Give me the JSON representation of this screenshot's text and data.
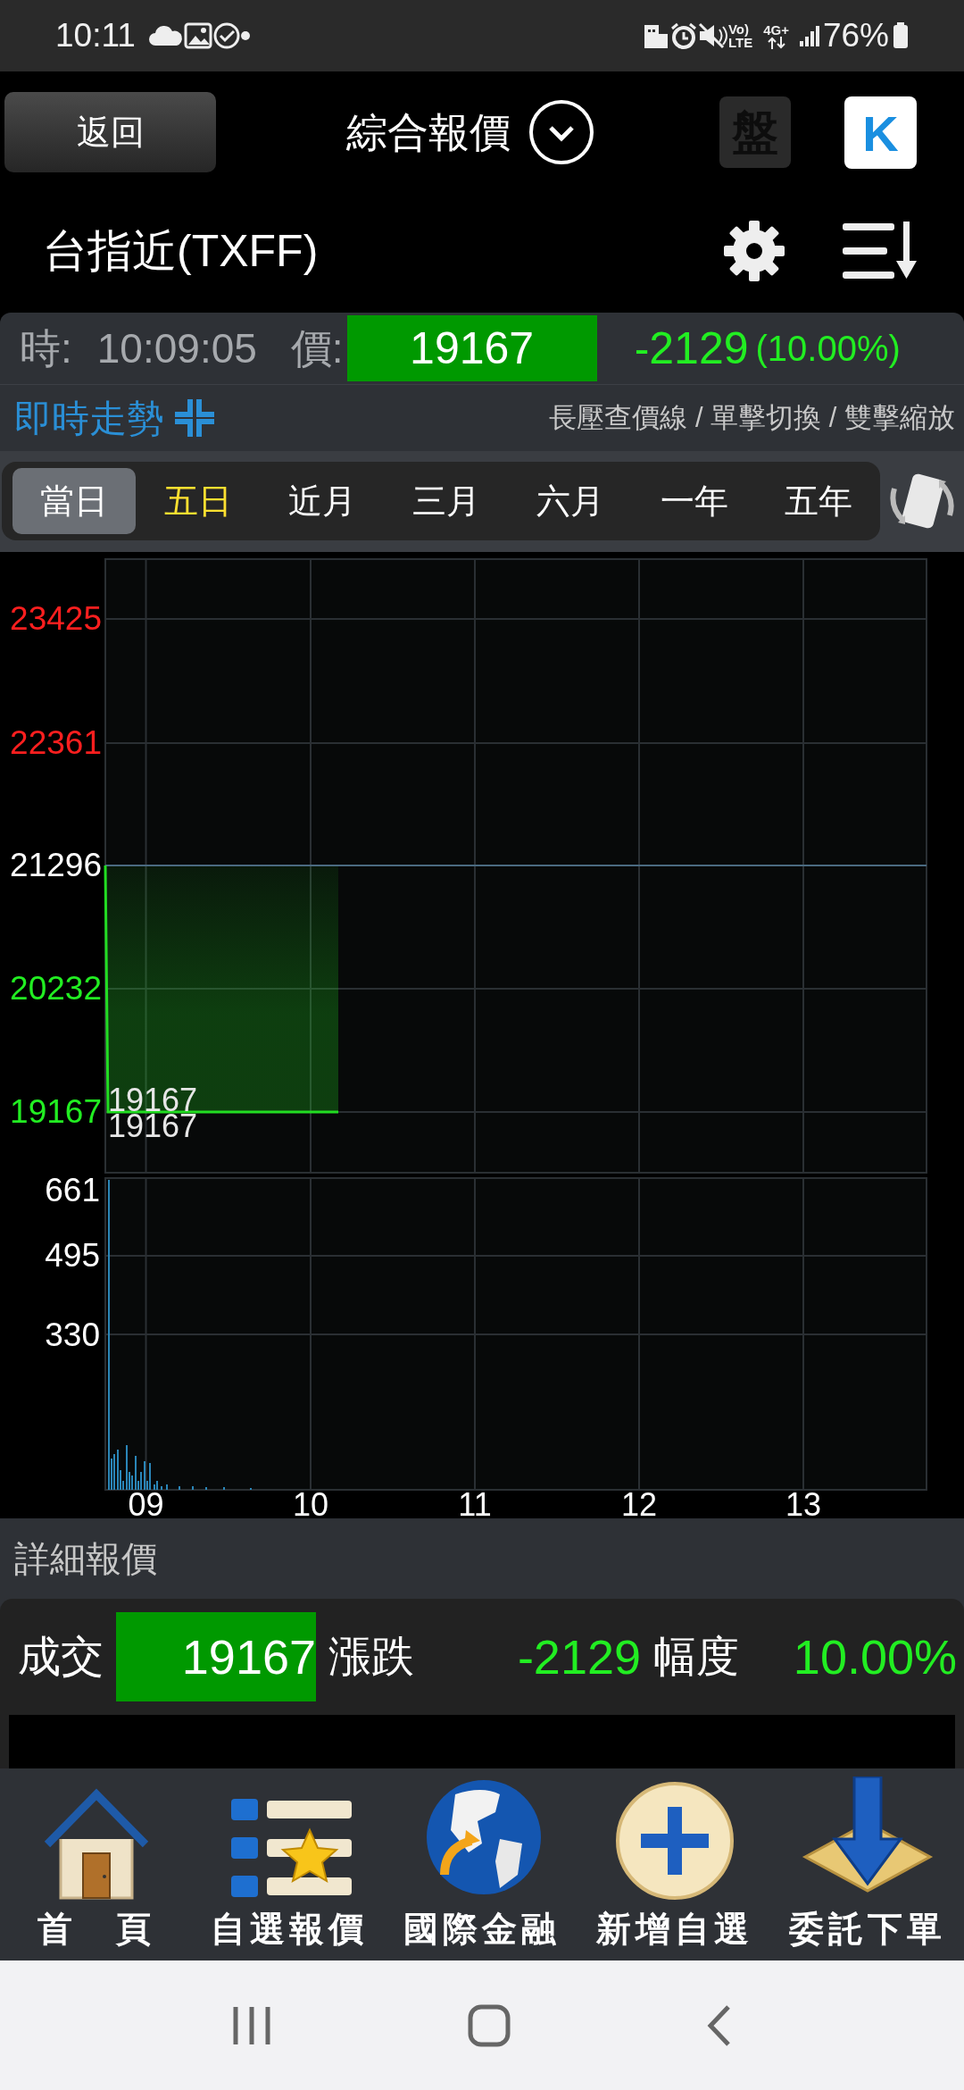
{
  "status_bar": {
    "time": "10:11",
    "volte_top": "Vo)",
    "volte_bottom": "LTE",
    "network": "4G+",
    "battery": "76%"
  },
  "header": {
    "back_button": "返回",
    "title": "綜合報價",
    "board_button": "盤",
    "k_button": "K"
  },
  "instrument": {
    "name": "台指近(TXFF)"
  },
  "quote_bar": {
    "time_label": "時:",
    "time": "10:09:05",
    "price_label": "價:",
    "price": "19167",
    "change": "-2129",
    "change_percent": "(10.00%)"
  },
  "chart_header": {
    "title": "即時走勢",
    "hint": "長壓查價線 / 單擊切換 / 雙擊縮放"
  },
  "tabs": [
    {
      "label": "當日",
      "selected": true,
      "highlighted": false
    },
    {
      "label": "五日",
      "selected": false,
      "highlighted": true
    },
    {
      "label": "近月",
      "selected": false,
      "highlighted": false
    },
    {
      "label": "三月",
      "selected": false,
      "highlighted": false
    },
    {
      "label": "六月",
      "selected": false,
      "highlighted": false
    },
    {
      "label": "一年",
      "selected": false,
      "highlighted": false
    },
    {
      "label": "五年",
      "selected": false,
      "highlighted": false
    }
  ],
  "price_chart": {
    "y_labels": [
      {
        "text": "23425",
        "color": "#ff1f1f"
      },
      {
        "text": "22361",
        "color": "#ff1f1f"
      },
      {
        "text": "21296",
        "color": "#ffffff"
      },
      {
        "text": "20232",
        "color": "#22ee22"
      },
      {
        "text": "19167",
        "color": "#22ee22"
      }
    ],
    "x_labels": [
      "09",
      "10",
      "11",
      "12",
      "13"
    ],
    "price_labels": [
      "19167",
      "19167"
    ]
  },
  "volume_chart": {
    "y_labels": [
      "661",
      "495",
      "330"
    ]
  },
  "detail": {
    "title": "詳細報價",
    "cells": [
      {
        "label": "成交",
        "value": "19167",
        "kind": "boxed"
      },
      {
        "label": "漲跌",
        "value": "-2129",
        "kind": "plain"
      },
      {
        "label": "幅度",
        "value": "10.00%",
        "kind": "plain"
      }
    ]
  },
  "bottom_nav": [
    {
      "label": "首　頁",
      "kind": "home"
    },
    {
      "label": "自選報價",
      "kind": "watchlist"
    },
    {
      "label": "國際金融",
      "kind": "globe"
    },
    {
      "label": "新增自選",
      "kind": "add"
    },
    {
      "label": "委託下單",
      "kind": "order"
    }
  ]
}
